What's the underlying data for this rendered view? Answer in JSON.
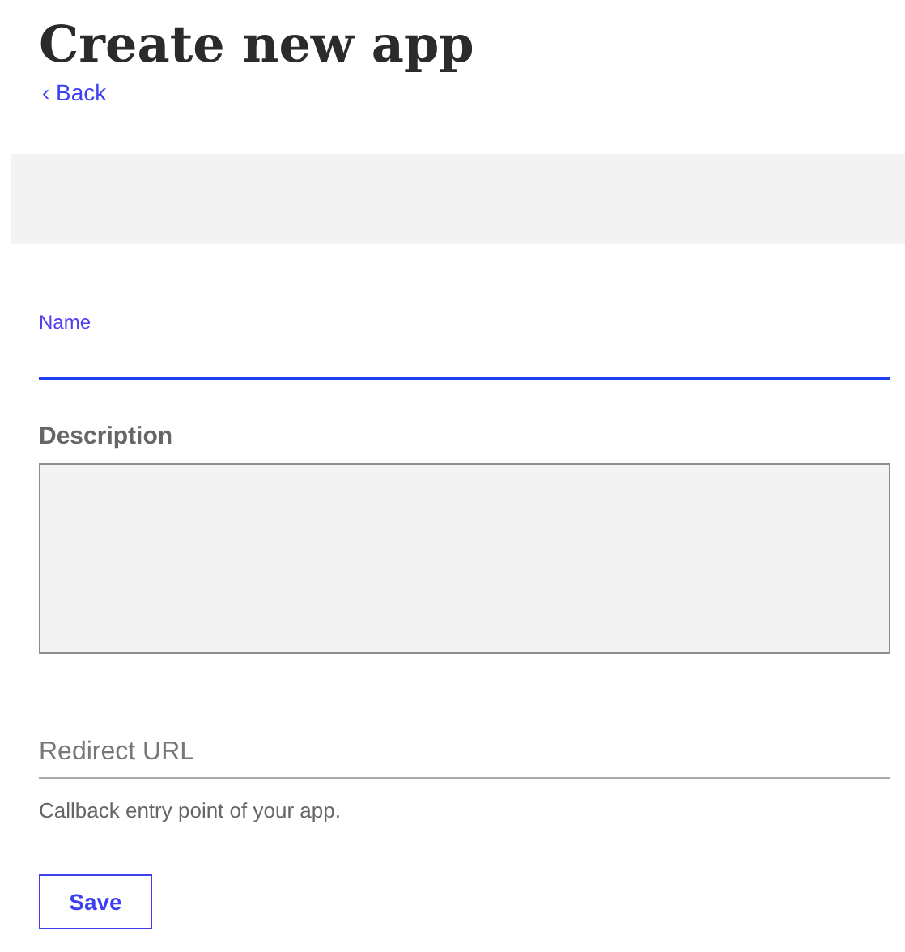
{
  "title": "Create new app",
  "back_link": {
    "icon": "‹",
    "label": "Back"
  },
  "name_field": {
    "label": "Name",
    "focused": true
  },
  "description_field": {
    "label": "Description"
  },
  "redirect_field": {
    "placeholder": "Redirect URL",
    "helper": "Callback entry point of your app."
  },
  "save_button": {
    "label": "Save"
  }
}
